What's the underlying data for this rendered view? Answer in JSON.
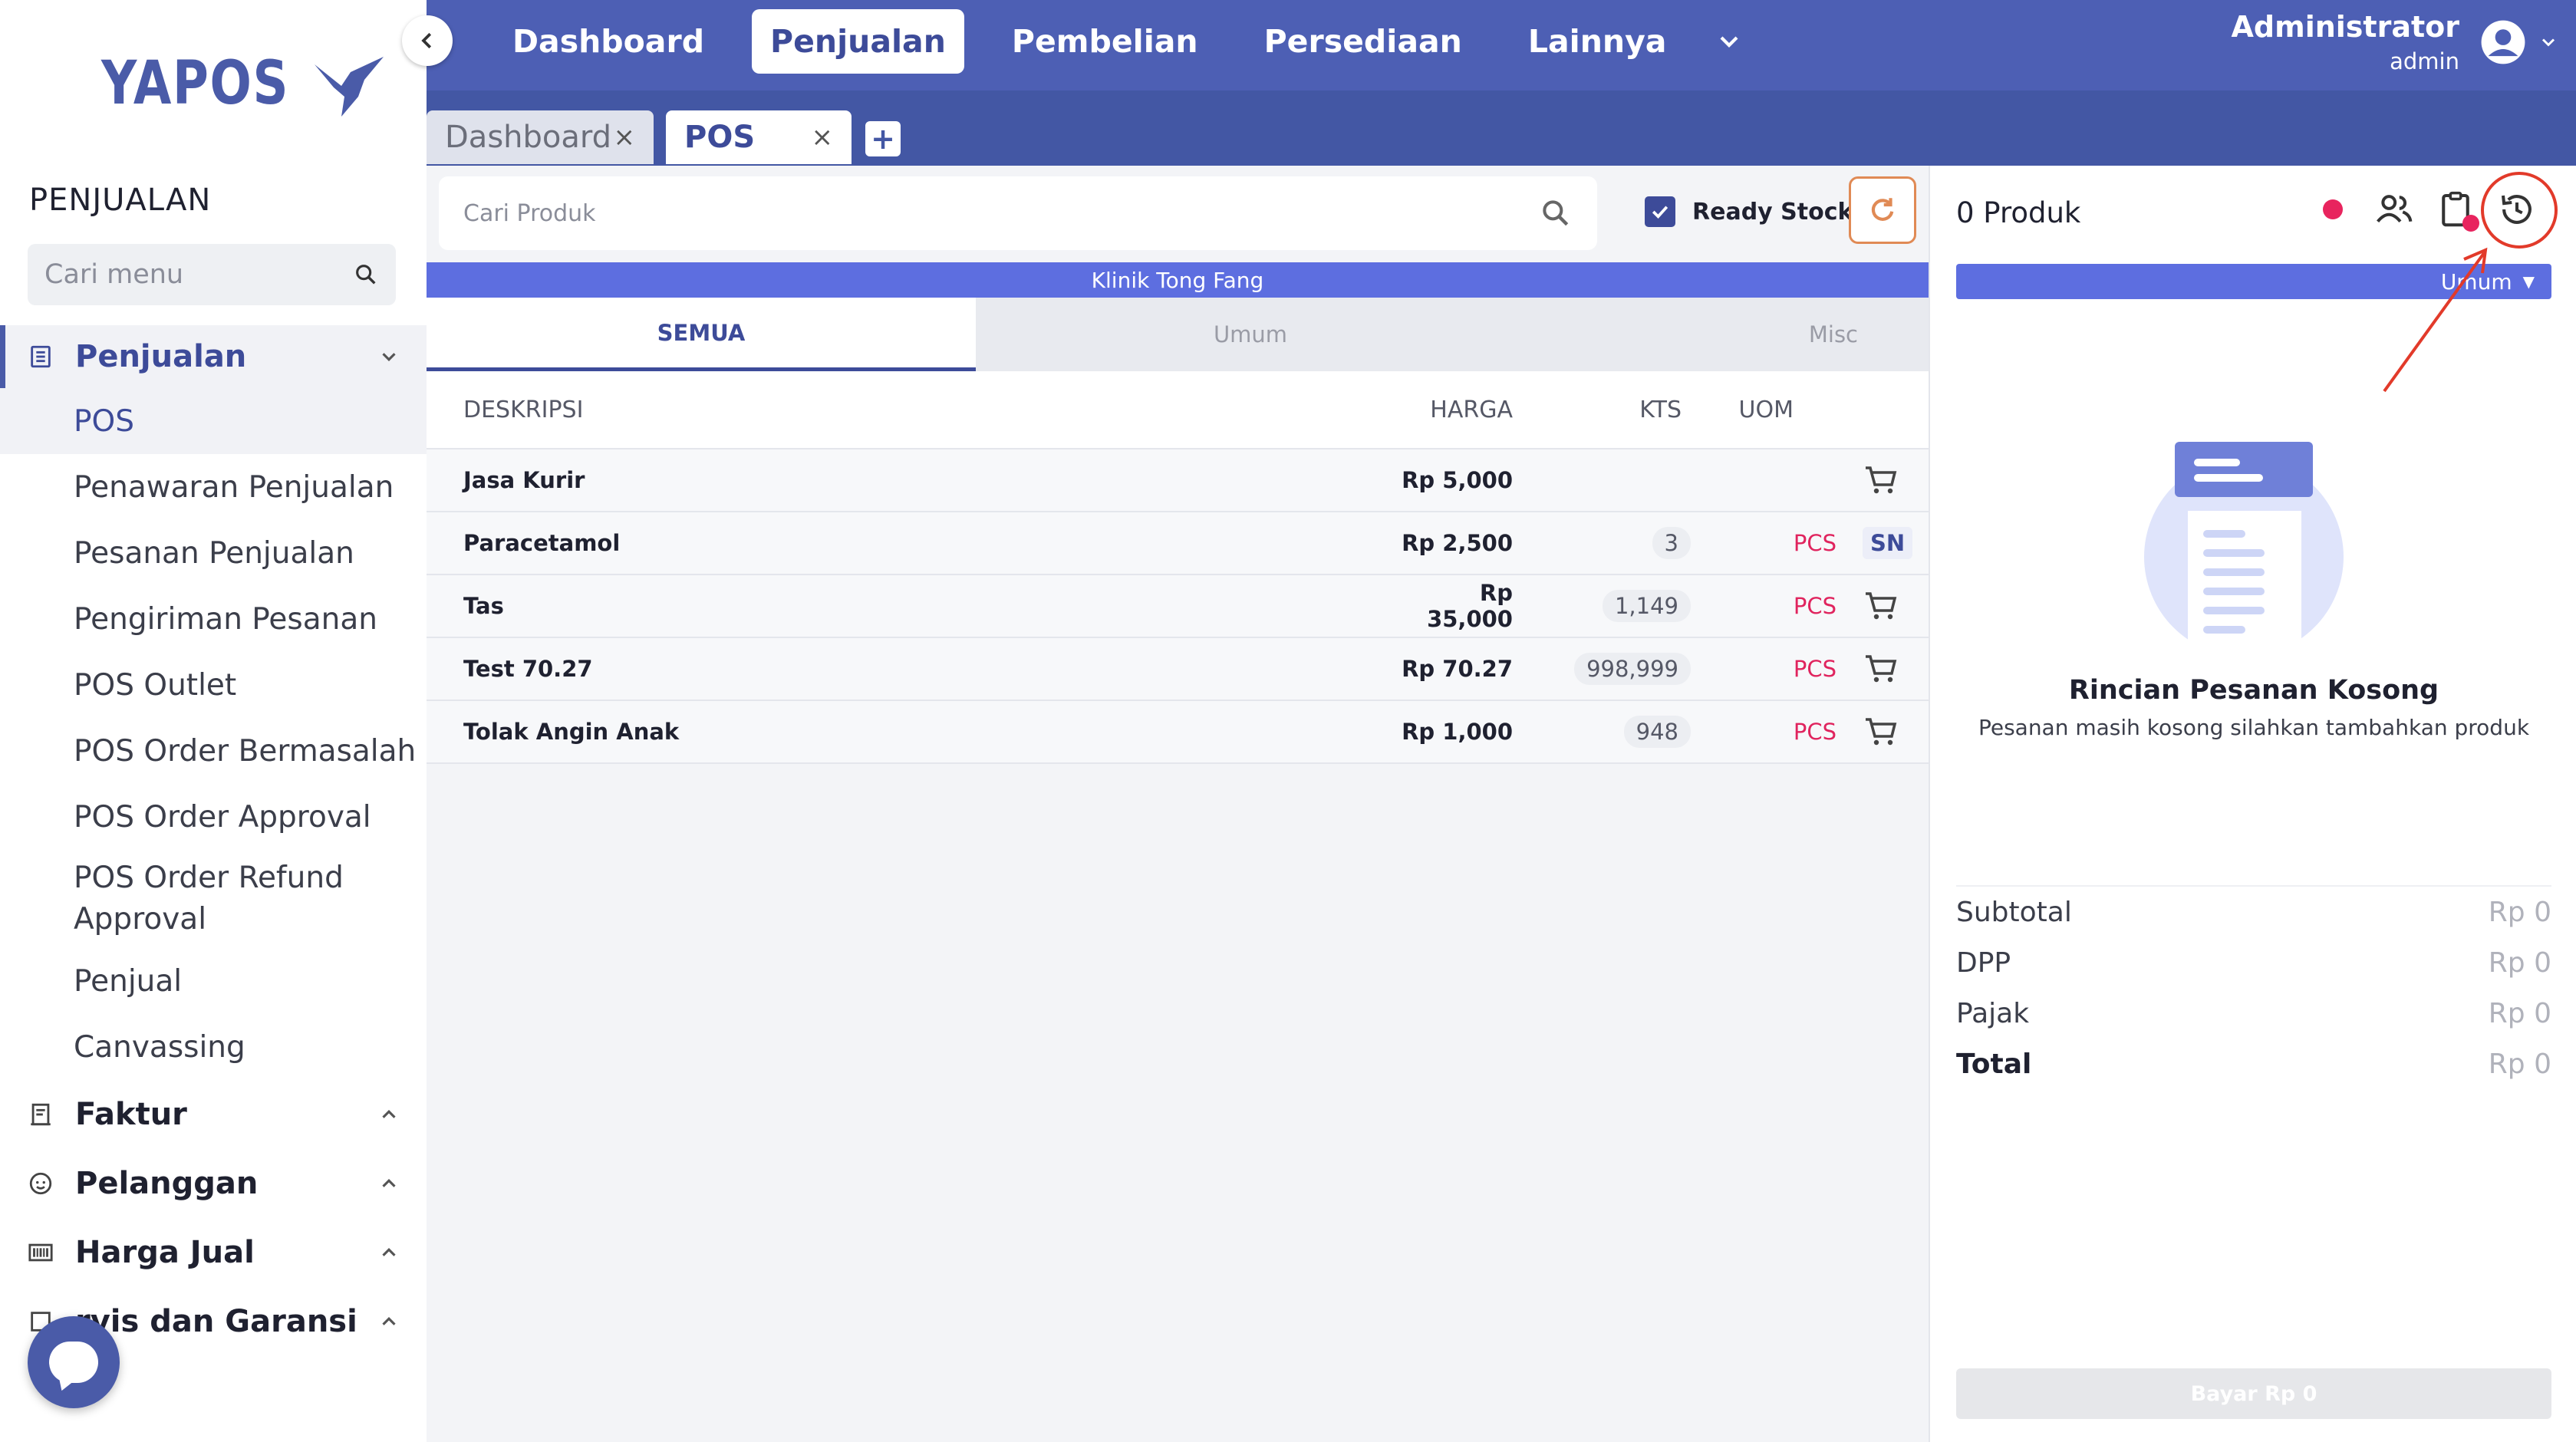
{
  "app": {
    "logo_text": "YAPOS"
  },
  "sidebar": {
    "heading": "PENJUALAN",
    "search_placeholder": "Cari menu",
    "groups": [
      {
        "label": "Penjualan",
        "icon": "receipt-icon",
        "expanded": true,
        "items": [
          {
            "label": "POS",
            "active": true
          },
          {
            "label": "Penawaran Penjualan"
          },
          {
            "label": "Pesanan Penjualan"
          },
          {
            "label": "Pengiriman Pesanan"
          },
          {
            "label": "POS Outlet"
          },
          {
            "label": "POS Order Bermasalah"
          },
          {
            "label": "POS Order Approval"
          },
          {
            "label": "POS Order Refund Approval"
          },
          {
            "label": "Penjual"
          },
          {
            "label": "Canvassing"
          }
        ]
      },
      {
        "label": "Faktur",
        "icon": "invoice-icon"
      },
      {
        "label": "Pelanggan",
        "icon": "face-icon"
      },
      {
        "label": "Harga Jual",
        "icon": "barcode-icon"
      },
      {
        "label": "rvis dan Garansi",
        "icon": "service-icon"
      }
    ]
  },
  "topnav": {
    "items": [
      "Dashboard",
      "Penjualan",
      "Pembelian",
      "Persediaan",
      "Lainnya"
    ],
    "active": "Penjualan",
    "user_name": "Administrator",
    "user_role": "admin"
  },
  "tabs": [
    {
      "label": "Dashboard",
      "close": "×"
    },
    {
      "label": "POS",
      "close": "×",
      "active": true
    }
  ],
  "tab_add": "+",
  "products": {
    "search_placeholder": "Cari Produk",
    "ready_stock_label": "Ready Stock",
    "ready_stock_checked": true,
    "store_name": "Klinik Tong Fang",
    "categories": [
      "SEMUA",
      "Umum",
      "Misc"
    ],
    "columns": {
      "desc": "DESKRIPSI",
      "price": "HARGA",
      "qty": "KTS",
      "uom": "UOM"
    },
    "rows": [
      {
        "desc": "Jasa Kurir",
        "price": "Rp 5,000",
        "qty": "",
        "uom": "",
        "action": "cart-icon"
      },
      {
        "desc": "Paracetamol",
        "price": "Rp 2,500",
        "qty": "3",
        "uom": "PCS",
        "action": "SN"
      },
      {
        "desc": "Tas",
        "price": "Rp 35,000",
        "qty": "1,149",
        "uom": "PCS",
        "action": "cart-icon"
      },
      {
        "desc": "Test 70.27",
        "price": "Rp 70.27",
        "qty": "998,999",
        "uom": "PCS",
        "action": "cart-icon"
      },
      {
        "desc": "Tolak Angin Anak",
        "price": "Rp 1,000",
        "qty": "948",
        "uom": "PCS",
        "action": "cart-icon"
      }
    ]
  },
  "order": {
    "count_label": "0 Produk",
    "customer_type": "Umum",
    "empty_title": "Rincian Pesanan Kosong",
    "empty_subtitle": "Pesanan masih kosong silahkan tambahkan produk",
    "totals": [
      {
        "label": "Subtotal",
        "value": "Rp 0"
      },
      {
        "label": "DPP",
        "value": "Rp 0"
      },
      {
        "label": "Pajak",
        "value": "Rp 0"
      },
      {
        "label": "Total",
        "value": "Rp 0"
      }
    ],
    "pay_label": "Bayar Rp 0"
  },
  "colors": {
    "primary": "#4d5fb4",
    "accent_blue": "#5d6ee0",
    "danger": "#e8245e",
    "highlight_annotation": "#e23a2a"
  }
}
